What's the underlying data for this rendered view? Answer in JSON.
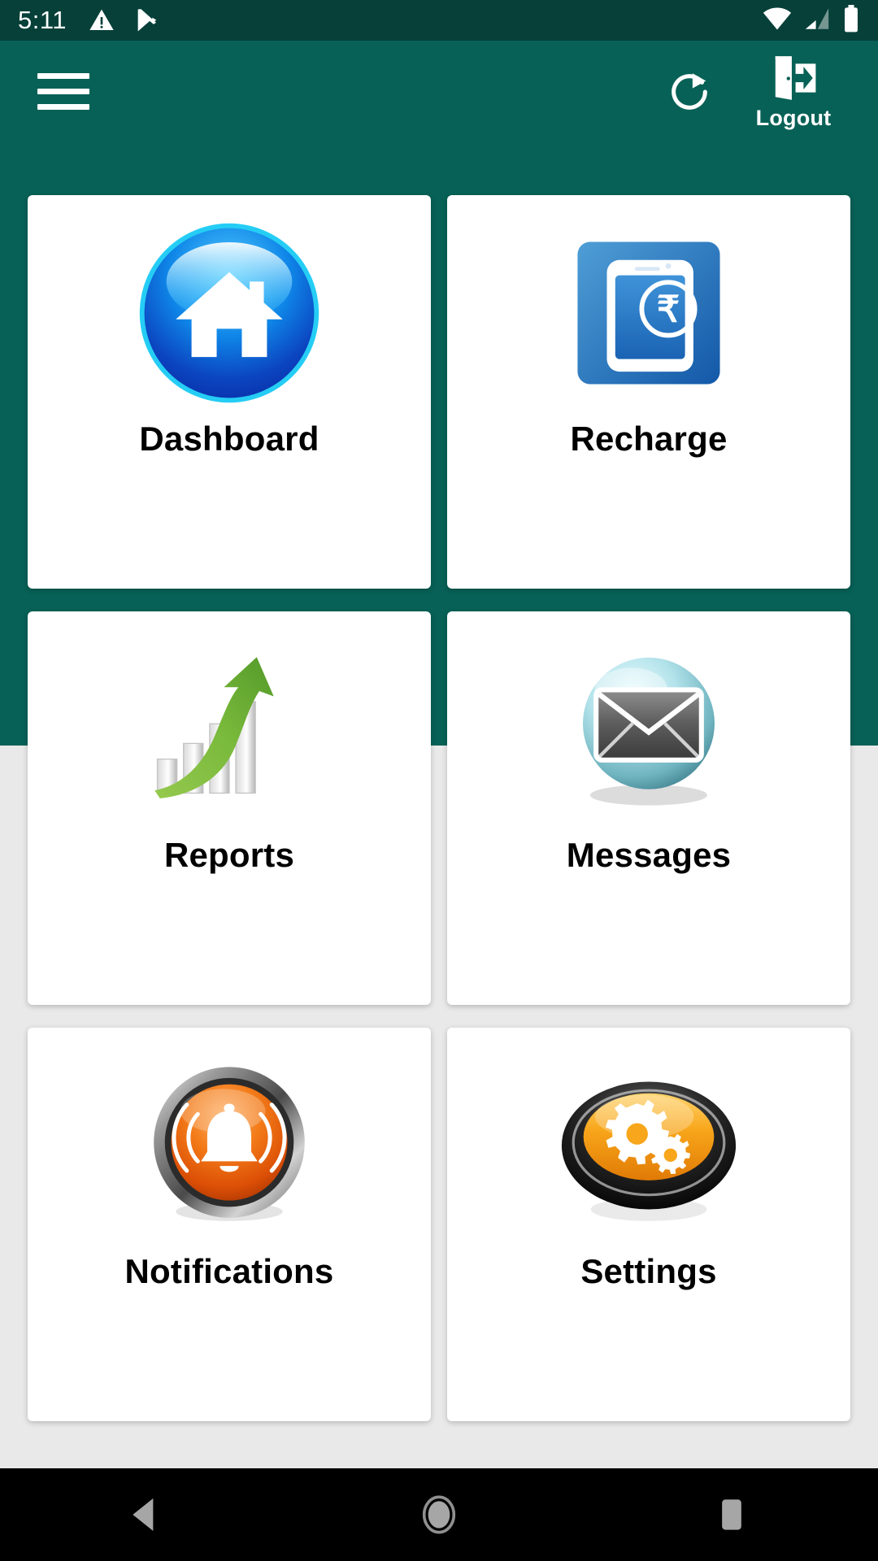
{
  "status_bar": {
    "time": "5:11",
    "icons": [
      "warning-triangle-icon",
      "play-store-icon"
    ],
    "right_icons": [
      "wifi-icon",
      "cellular-signal-icon",
      "battery-icon"
    ],
    "background_color": "#064039",
    "signal_bars_filled": 2,
    "signal_bars_total": 4,
    "battery_level_percent": 100
  },
  "app_bar": {
    "background_color": "#076156",
    "menu_icon": "hamburger-menu-icon",
    "refresh_icon": "refresh-icon",
    "logout_icon": "logout-door-icon",
    "logout_label": "Logout"
  },
  "theme": {
    "primary": "#076156",
    "status_bar": "#064039",
    "page_background": "#e9e9e9",
    "tile_background": "#ffffff",
    "label_color": "#000000"
  },
  "grid": {
    "columns": 2,
    "tiles": [
      {
        "id": "dashboard",
        "label": "Dashboard",
        "icon": "home-icon",
        "icon_color": "#0a5fd0"
      },
      {
        "id": "recharge",
        "label": "Recharge",
        "icon": "mobile-rupee-icon",
        "icon_color": "#2b7fc4"
      },
      {
        "id": "reports",
        "label": "Reports",
        "icon": "growth-chart-arrow-icon",
        "icon_color": "#79bf3f"
      },
      {
        "id": "messages",
        "label": "Messages",
        "icon": "envelope-icon",
        "icon_color": "#7fc3cb"
      },
      {
        "id": "notifications",
        "label": "Notifications",
        "icon": "bell-icon",
        "icon_color": "#ef6c1a"
      },
      {
        "id": "settings",
        "label": "Settings",
        "icon": "gears-icon",
        "icon_color": "#f59a12"
      }
    ]
  },
  "nav_bar": {
    "background_color": "#000000",
    "buttons": [
      {
        "id": "back",
        "icon": "back-triangle-icon"
      },
      {
        "id": "home",
        "icon": "home-circle-icon"
      },
      {
        "id": "recents",
        "icon": "recents-square-icon"
      }
    ]
  }
}
